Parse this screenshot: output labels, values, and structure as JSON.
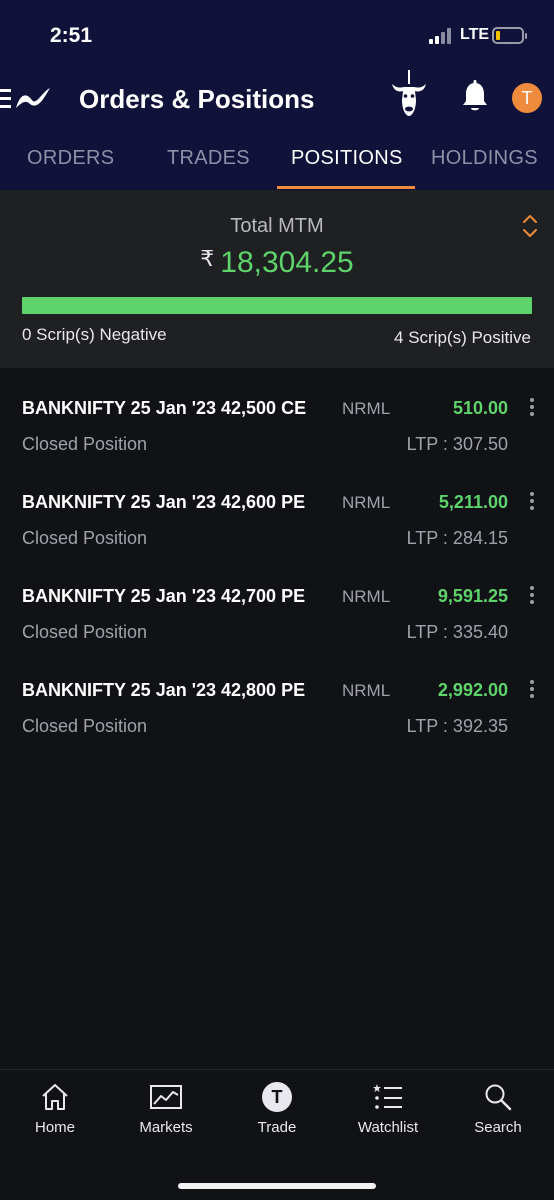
{
  "status_bar": {
    "time": "2:51",
    "network": "LTE",
    "battery_level": 0.15
  },
  "header": {
    "title": "Orders & Positions",
    "avatar_initial": "T",
    "tabs": [
      {
        "label": "ORDERS",
        "active": false
      },
      {
        "label": "TRADES",
        "active": false
      },
      {
        "label": "POSITIONS",
        "active": true
      },
      {
        "label": "HOLDINGS",
        "active": false
      }
    ]
  },
  "summary": {
    "label": "Total MTM",
    "currency_symbol": "₹",
    "value": "18,304.25",
    "positive_fraction": 1.0,
    "negative_text": "0 Scrip(s) Negative",
    "positive_text": "4 Scrip(s) Positive"
  },
  "positions": [
    {
      "name": "BANKNIFTY 25 Jan '23 42,500 CE",
      "product": "NRML",
      "pnl": "510.00",
      "status": "Closed Position",
      "ltp": "LTP : 307.50"
    },
    {
      "name": "BANKNIFTY 25 Jan '23 42,600 PE",
      "product": "NRML",
      "pnl": "5,211.00",
      "status": "Closed Position",
      "ltp": "LTP : 284.15"
    },
    {
      "name": "BANKNIFTY 25 Jan '23 42,700 PE",
      "product": "NRML",
      "pnl": "9,591.25",
      "status": "Closed Position",
      "ltp": "LTP : 335.40"
    },
    {
      "name": "BANKNIFTY 25 Jan '23 42,800 PE",
      "product": "NRML",
      "pnl": "2,992.00",
      "status": "Closed Position",
      "ltp": "LTP : 392.35"
    }
  ],
  "bottom_nav": {
    "home": "Home",
    "markets": "Markets",
    "trade": "Trade",
    "trade_initial": "T",
    "watchlist": "Watchlist",
    "search": "Search"
  },
  "colors": {
    "header_bg": "#11123a",
    "accent": "#ef8b3c",
    "profit": "#5ed36b",
    "panel_bg": "#1f2022"
  },
  "icons": [
    "menu-icon",
    "app-logo-icon",
    "bull-icon",
    "bell-icon",
    "sort-icon",
    "more-vertical-icon",
    "home-icon",
    "markets-chart-icon",
    "watchlist-icon",
    "search-icon"
  ]
}
